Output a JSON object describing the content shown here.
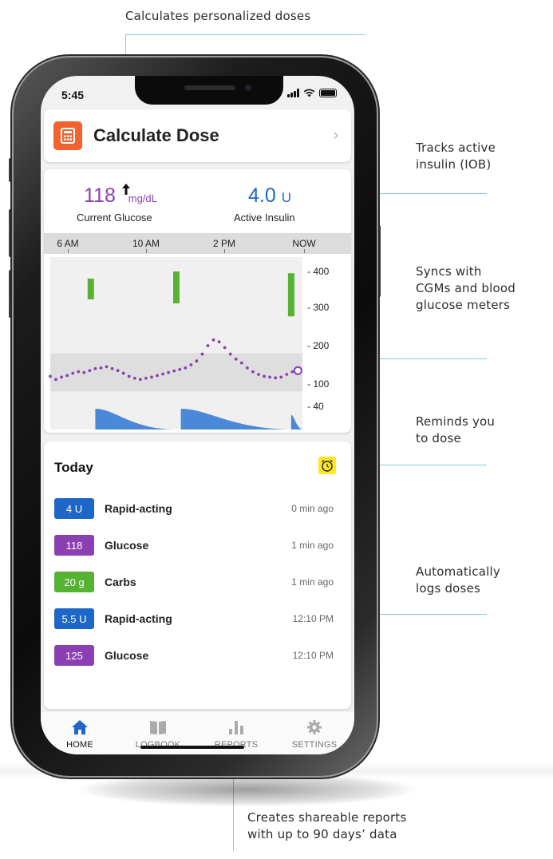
{
  "callouts": {
    "doses": "Calculates personalized doses",
    "iob_line1": "Tracks active",
    "iob_line2": "insulin (IOB)",
    "cgm_line1": "Syncs with",
    "cgm_line2": "CGMs and blood",
    "cgm_line3": "glucose meters",
    "remind_line1": "Reminds you",
    "remind_line2": "to dose",
    "logs_line1": "Automatically",
    "logs_line2": "logs doses",
    "reports_line1": "Creates shareable reports",
    "reports_line2": "with up to 90 days’ data"
  },
  "status_bar": {
    "time": "5:45"
  },
  "calculate": {
    "title": "Calculate Dose",
    "chevron": "›"
  },
  "glucose": {
    "value": "118",
    "unit": "mg/dL",
    "trend": "rising",
    "label": "Current Glucose",
    "color": "#8a3fb3"
  },
  "insulin": {
    "value": "4.0",
    "unit": "U",
    "label": "Active Insulin",
    "color": "#1e67c8"
  },
  "chart_data": {
    "type": "line",
    "x_ticks": [
      "6 AM",
      "10 AM",
      "2 PM",
      "NOW"
    ],
    "y_ticks": [
      400,
      300,
      200,
      100,
      40
    ],
    "target_range": [
      80,
      180
    ],
    "glucose_series": {
      "color": "#8a3fb3",
      "points": [
        [
          0,
          120
        ],
        [
          0.25,
          112
        ],
        [
          0.5,
          118
        ],
        [
          0.75,
          122
        ],
        [
          1,
          128
        ],
        [
          1.25,
          132
        ],
        [
          1.5,
          130
        ],
        [
          1.75,
          135
        ],
        [
          2,
          140
        ],
        [
          2.25,
          142
        ],
        [
          2.5,
          145
        ],
        [
          2.75,
          140
        ],
        [
          3,
          135
        ],
        [
          3.25,
          128
        ],
        [
          3.5,
          120
        ],
        [
          3.75,
          115
        ],
        [
          4,
          112
        ],
        [
          4.25,
          115
        ],
        [
          4.5,
          118
        ],
        [
          4.75,
          122
        ],
        [
          5,
          126
        ],
        [
          5.25,
          130
        ],
        [
          5.5,
          134
        ],
        [
          5.75,
          138
        ],
        [
          6,
          142
        ],
        [
          6.25,
          150
        ],
        [
          6.5,
          160
        ],
        [
          6.75,
          178
        ],
        [
          7,
          200
        ],
        [
          7.25,
          215
        ],
        [
          7.5,
          210
        ],
        [
          7.75,
          195
        ],
        [
          8,
          178
        ],
        [
          8.25,
          165
        ],
        [
          8.5,
          155
        ],
        [
          8.75,
          142
        ],
        [
          9,
          132
        ],
        [
          9.25,
          125
        ],
        [
          9.5,
          120
        ],
        [
          9.75,
          118
        ],
        [
          10,
          116
        ],
        [
          10.25,
          118
        ],
        [
          10.5,
          125
        ],
        [
          10.75,
          132
        ],
        [
          11,
          135
        ]
      ]
    },
    "dose_bars": {
      "color": "#55b233",
      "x": [
        1.8,
        5.6,
        10.7
      ],
      "height_values": [
        340,
        360,
        355
      ]
    },
    "active_insulin_curves": {
      "color": "#4a88d8",
      "curves": [
        {
          "start": 2.0,
          "end": 5.4,
          "peak": 1
        },
        {
          "start": 5.8,
          "end": 10.6,
          "peak": 1
        },
        {
          "start": 10.7,
          "end": 11.2,
          "peak": 0.7
        }
      ]
    }
  },
  "today": {
    "title": "Today",
    "reminder_color": "#ffe820",
    "entries": [
      {
        "badge": "4 U",
        "color": "#1e67c8",
        "name": "Rapid-acting",
        "time": "0 min ago"
      },
      {
        "badge": "118",
        "color": "#8a3fb3",
        "name": "Glucose",
        "time": "1 min ago"
      },
      {
        "badge": "20 g",
        "color": "#55b233",
        "name": "Carbs",
        "time": "1 min ago"
      },
      {
        "badge": "5.5 U",
        "color": "#1e67c8",
        "name": "Rapid-acting",
        "time": "12:10 PM"
      },
      {
        "badge": "125",
        "color": "#8a3fb3",
        "name": "Glucose",
        "time": "12:10 PM"
      }
    ]
  },
  "tabs": [
    {
      "label": "HOME",
      "icon": "home-icon",
      "active": true
    },
    {
      "label": "LOGBOOK",
      "icon": "book-icon",
      "active": false
    },
    {
      "label": "REPORTS",
      "icon": "bar-chart-icon",
      "active": false
    },
    {
      "label": "SETTINGS",
      "icon": "gear-icon",
      "active": false
    }
  ],
  "accent_colors": {
    "active_tab": "#1e67c8",
    "inactive": "#aaaaaa",
    "callout_line": "#8ec7dd"
  }
}
